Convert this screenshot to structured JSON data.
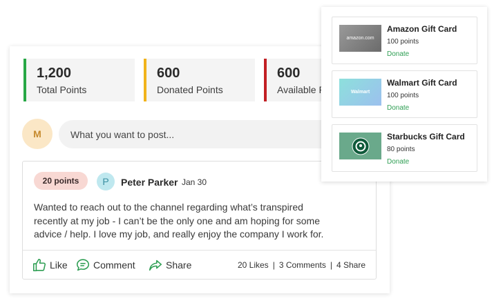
{
  "stats": {
    "total": {
      "value": "1,200",
      "label": "Total Points"
    },
    "donated": {
      "value": "600",
      "label": "Donated Points"
    },
    "available": {
      "value": "600",
      "label": "Available Points"
    }
  },
  "composer": {
    "avatar_initial": "M",
    "placeholder": "What you want to post..."
  },
  "post": {
    "points_badge": "20 points",
    "avatar_initial": "P",
    "author": "Peter Parker",
    "date": "Jan 30",
    "body": "Wanted to reach out to the channel regarding what’s transpired recently at my job - I can’t be the only one and am hoping for some advice / help. I love my job, and really enjoy the company I work for.",
    "actions": {
      "like": "Like",
      "comment": "Comment",
      "share": "Share"
    },
    "counts": {
      "likes": "20 Likes",
      "comments": "3 Comments",
      "shares": "4 Share",
      "separator": "|"
    }
  },
  "gift_cards": [
    {
      "name": "Amazon Gift Card",
      "points": "100 points",
      "action": "Donate",
      "image_text": "amazon.com",
      "icon": "amazon-logo"
    },
    {
      "name": "Walmart Gift Card",
      "points": "100 points",
      "action": "Donate",
      "image_text": "Walmart",
      "icon": "walmart-logo"
    },
    {
      "name": "Starbucks Gift Card",
      "points": "80 points",
      "action": "Donate",
      "image_text": "",
      "icon": "starbucks-logo"
    }
  ],
  "colors": {
    "total_accent": "#27a745",
    "donated_accent": "#f1b31b",
    "available_accent": "#c21f24",
    "donate_link": "#2e9e53",
    "action_icon": "#2e9e53"
  }
}
